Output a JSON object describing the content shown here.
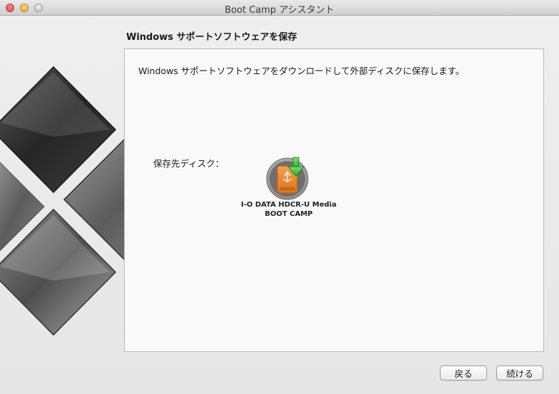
{
  "window": {
    "title": "Boot Camp アシスタント"
  },
  "page": {
    "heading": "Windows サポートソフトウェアを保存",
    "description": "Windows サポートソフトウェアをダウンロードして外部ディスクに保存します。",
    "destination_label": "保存先ディスク："
  },
  "disk": {
    "name_line1": "I-O DATA HDCR-U Media",
    "name_line2": "BOOT CAMP",
    "icon": "usb-drive-download-icon"
  },
  "buttons": {
    "back_label": "戻る",
    "continue_label": "続ける"
  },
  "colors": {
    "disk_orange": "#e8892e",
    "download_arrow_green": "#3cc23c"
  }
}
